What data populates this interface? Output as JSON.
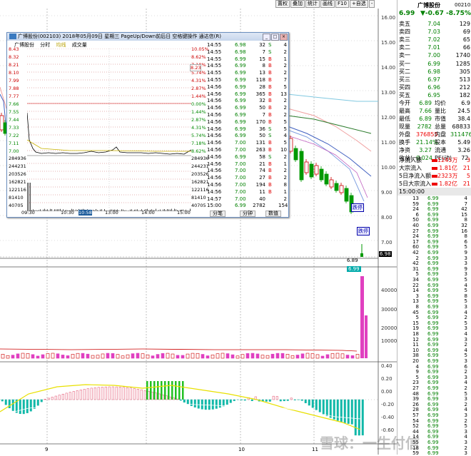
{
  "toolbar": {
    "items": [
      "置权",
      "叠加",
      "统计",
      "画线",
      "F10",
      "+自选",
      "-"
    ]
  },
  "right_axis_labels": [
    "16.00",
    "15.00",
    "14.00",
    "13.00",
    "12.00",
    "11.00",
    "10.00",
    "9.00",
    "8.00",
    "7.00",
    "6.98",
    "40000",
    "30000",
    "20000",
    "10000",
    "0.40",
    "0.20",
    "0.00",
    "-0.20",
    "-0.40",
    "-0.60"
  ],
  "chart": {
    "marker_price": "6.89",
    "price_tag": "6.99",
    "badge_1": "跌停",
    "badge_2": "跌停",
    "bottom_ticks": [
      "9",
      "10",
      "11"
    ]
  },
  "quote": {
    "name": "广博股份",
    "code": "002103",
    "price": "6.99",
    "change": "▼-0.67",
    "pct": "-8.75%",
    "asks": [
      {
        "label": "卖五",
        "price": "7.04",
        "vol": "129"
      },
      {
        "label": "卖四",
        "price": "7.03",
        "vol": "69"
      },
      {
        "label": "卖三",
        "price": "7.02",
        "vol": "65"
      },
      {
        "label": "卖二",
        "price": "7.01",
        "vol": "66"
      },
      {
        "label": "卖一",
        "price": "7.00",
        "vol": "1740"
      }
    ],
    "bids": [
      {
        "label": "买一",
        "price": "6.99",
        "vol": "1285"
      },
      {
        "label": "买二",
        "price": "6.98",
        "vol": "305"
      },
      {
        "label": "买三",
        "price": "6.97",
        "vol": "513"
      },
      {
        "label": "买四",
        "price": "6.96",
        "vol": "212"
      },
      {
        "label": "买五",
        "price": "6.95",
        "vol": "182"
      }
    ],
    "stats": [
      {
        "a": "今开",
        "b": "6.89",
        "c": "均价",
        "d": "6.9"
      },
      {
        "a": "最高",
        "b": "7.66",
        "c": "量比",
        "d": "24.5"
      },
      {
        "a": "最低",
        "b": "6.89",
        "c": "市值",
        "d": "38.4"
      },
      {
        "a": "现量",
        "b": "2782",
        "c": "总量",
        "d": "68833"
      },
      {
        "a": "外盘",
        "b": "376855",
        "c": "内盘",
        "d": "311476"
      },
      {
        "a": "换手",
        "b": "21.14%",
        "c": "股本",
        "d": "5.49"
      },
      {
        "a": "净资",
        "b": "3.27",
        "c": "流通",
        "d": "3.26"
      },
      {
        "a": "收益(一)",
        "b": "0.024",
        "c": "PE(动)",
        "d": "72."
      }
    ],
    "flows": [
      {
        "a": "净流入额",
        "b": "1245万",
        "c": "3"
      },
      {
        "a": "大宗流入",
        "b": "1.81亿",
        "c": "21"
      },
      {
        "a": "5日净流入额",
        "b": "2323万",
        "c": "5"
      },
      {
        "a": "5日大宗流入",
        "b": "1.82亿",
        "c": "21"
      }
    ],
    "trades_header": "15:00:00",
    "trades": [
      {
        "t": "13",
        "p": "6.99",
        "v": "4"
      },
      {
        "t": "59",
        "p": "6.99",
        "v": "7"
      },
      {
        "t": "24",
        "p": "6.99",
        "v": "42"
      },
      {
        "t": "6",
        "p": "6.99",
        "v": "15"
      },
      {
        "t": "50",
        "p": "6.99",
        "v": "8"
      },
      {
        "t": "40",
        "p": "6.99",
        "v": "32"
      },
      {
        "t": "27",
        "p": "6.99",
        "v": "16"
      },
      {
        "t": "24",
        "p": "6.99",
        "v": "8"
      },
      {
        "t": "17",
        "p": "6.99",
        "v": "6"
      },
      {
        "t": "60",
        "p": "6.99",
        "v": "5"
      },
      {
        "t": "42",
        "p": "6.99",
        "v": "9"
      },
      {
        "t": "2",
        "p": "6.99",
        "v": "3"
      },
      {
        "t": "42",
        "p": "6.99",
        "v": "3"
      },
      {
        "t": "31",
        "p": "6.99",
        "v": "9"
      },
      {
        "t": "5",
        "p": "6.99",
        "v": "3"
      },
      {
        "t": "34",
        "p": "6.99",
        "v": "5"
      },
      {
        "t": "22",
        "p": "6.99",
        "v": "4"
      },
      {
        "t": "14",
        "p": "6.99",
        "v": "5"
      },
      {
        "t": "3",
        "p": "6.99",
        "v": "8"
      },
      {
        "t": "13",
        "p": "6.99",
        "v": "5"
      },
      {
        "t": "8",
        "p": "6.99",
        "v": "3"
      },
      {
        "t": "45",
        "p": "6.99",
        "v": "4"
      },
      {
        "t": "5",
        "p": "6.99",
        "v": "2"
      },
      {
        "t": "15",
        "p": "6.99",
        "v": "5"
      },
      {
        "t": "19",
        "p": "6.99",
        "v": "3"
      },
      {
        "t": "18",
        "p": "6.99",
        "v": "4"
      },
      {
        "t": "12",
        "p": "6.99",
        "v": "3"
      },
      {
        "t": "11",
        "p": "6.99",
        "v": "2"
      },
      {
        "t": "10",
        "p": "6.99",
        "v": "4"
      },
      {
        "t": "38",
        "p": "6.99",
        "v": "5"
      },
      {
        "t": "20",
        "p": "6.99",
        "v": "3"
      },
      {
        "t": "4",
        "p": "6.99",
        "v": "6"
      },
      {
        "t": "9",
        "p": "6.99",
        "v": "2"
      },
      {
        "t": "5",
        "p": "6.99",
        "v": "3"
      },
      {
        "t": "23",
        "p": "6.99",
        "v": "4"
      },
      {
        "t": "27",
        "p": "6.99",
        "v": "2"
      },
      {
        "t": "48",
        "p": "6.99",
        "v": "5"
      },
      {
        "t": "39",
        "p": "6.99",
        "v": "3"
      },
      {
        "t": "26",
        "p": "6.99",
        "v": "2"
      },
      {
        "t": "28",
        "p": "6.99",
        "v": "4"
      },
      {
        "t": "57",
        "p": "6.99",
        "v": "3"
      },
      {
        "t": "54",
        "p": "6.99",
        "v": "2"
      },
      {
        "t": "52",
        "p": "6.99",
        "v": "5"
      },
      {
        "t": "44",
        "p": "6.99",
        "v": "3"
      },
      {
        "t": "14",
        "p": "6.99",
        "v": "4"
      },
      {
        "t": "55",
        "p": "6.99",
        "v": "3"
      },
      {
        "t": "18",
        "p": "6.99",
        "v": "2"
      },
      {
        "t": "59",
        "p": "6.99",
        "v": "3"
      }
    ]
  },
  "popup": {
    "title": "广博股份(002103)  2018年05月09日 星期三 PageUp/Down前后日 空格键操作 通达信(R)",
    "tabs": [
      "广博股份",
      "分时",
      "均线",
      "成交量"
    ],
    "left_labels": [
      "8.43",
      "8.32",
      "8.21",
      "8.10",
      "7.99",
      "7.88",
      "7.77",
      "7.66",
      "7.55",
      "7.44",
      "7.33",
      "7.22",
      "7.11",
      "7.00",
      "284936",
      "244231",
      "203526",
      "162821",
      "122116",
      "81410",
      "40705"
    ],
    "right_labels": [
      "10.05%",
      "8.62%",
      "7.18%",
      "5.74%",
      "4.31%",
      "2.87%",
      "1.44%",
      "0.00%",
      "1.44%",
      "2.87%",
      "4.31%",
      "5.74%",
      "7.18%",
      "8.62%",
      "284936",
      "244231",
      "203526",
      "162821",
      "122116",
      "81410",
      "40705"
    ],
    "current_price": "8.23",
    "x_labels": [
      "09:30",
      "10:30",
      "10:58",
      "13:00",
      "14:00",
      "15:00"
    ],
    "ticks": [
      {
        "t": "14:55",
        "p": "6.98",
        "v": "32",
        "d": "S",
        "n": "4"
      },
      {
        "t": "14:55",
        "p": "6.98",
        "v": "7",
        "d": "S",
        "n": "2"
      },
      {
        "t": "14:55",
        "p": "6.99",
        "v": "15",
        "d": "B",
        "n": "1"
      },
      {
        "t": "14:55",
        "p": "6.99",
        "v": "8",
        "d": "B",
        "n": "2"
      },
      {
        "t": "14:55",
        "p": "6.99",
        "v": "13",
        "d": "B",
        "n": "2"
      },
      {
        "t": "14:55",
        "p": "6.99",
        "v": "118",
        "d": "B",
        "n": "7"
      },
      {
        "t": "14:56",
        "p": "6.99",
        "v": "28",
        "d": "B",
        "n": "5"
      },
      {
        "t": "14:56",
        "p": "6.99",
        "v": "365",
        "d": "B",
        "n": "13"
      },
      {
        "t": "14:56",
        "p": "6.99",
        "v": "32",
        "d": "B",
        "n": "2"
      },
      {
        "t": "14:56",
        "p": "6.99",
        "v": "50",
        "d": "B",
        "n": "2"
      },
      {
        "t": "14:56",
        "p": "6.99",
        "v": "7",
        "d": "B",
        "n": "2"
      },
      {
        "t": "14:56",
        "p": "6.99",
        "v": "170",
        "d": "B",
        "n": "5"
      },
      {
        "t": "14:56",
        "p": "6.99",
        "v": "36",
        "d": "S",
        "n": "5"
      },
      {
        "t": "14:56",
        "p": "6.99",
        "v": "50",
        "d": "S",
        "n": "4"
      },
      {
        "t": "14:56",
        "p": "7.00",
        "v": "131",
        "d": "B",
        "n": "5"
      },
      {
        "t": "14:56",
        "p": "7.00",
        "v": "263",
        "d": "B",
        "n": "10"
      },
      {
        "t": "14:56",
        "p": "6.99",
        "v": "58",
        "d": "S",
        "n": "2"
      },
      {
        "t": "14:56",
        "p": "7.00",
        "v": "21",
        "d": "B",
        "n": "1"
      },
      {
        "t": "14:56",
        "p": "7.00",
        "v": "74",
        "d": "B",
        "n": "2"
      },
      {
        "t": "14:56",
        "p": "7.00",
        "v": "27",
        "d": "B",
        "n": "2"
      },
      {
        "t": "14:56",
        "p": "7.00",
        "v": "194",
        "d": "B",
        "n": "8"
      },
      {
        "t": "14:56",
        "p": "7.00",
        "v": "11",
        "d": "B",
        "n": "1"
      },
      {
        "t": "14:57",
        "p": "7.00",
        "v": "40",
        "d": "",
        "n": "2"
      },
      {
        "t": "15:00",
        "p": "6.99",
        "v": "2782",
        "d": "",
        "n": "154"
      }
    ],
    "buttons": [
      "分笔",
      "分钟",
      "数值"
    ]
  },
  "watermark": "雪球：一生付信"
}
